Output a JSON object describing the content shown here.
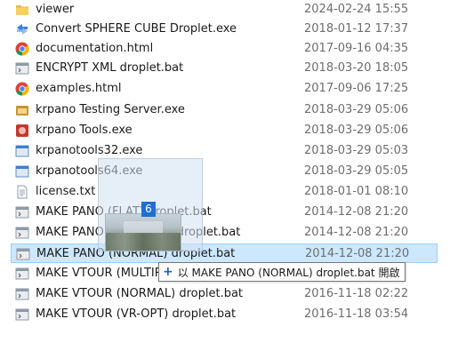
{
  "files": [
    {
      "name": "viewer",
      "date": "2024-02-24 15:55",
      "icon": "folder-icon"
    },
    {
      "name": "Convert SPHERE CUBE Droplet.exe",
      "date": "2018-01-12 17:37",
      "icon": "convert-app-icon"
    },
    {
      "name": "documentation.html",
      "date": "2017-09-16 04:35",
      "icon": "chrome-icon"
    },
    {
      "name": "ENCRYPT XML droplet.bat",
      "date": "2018-03-20 18:05",
      "icon": "bat-file-icon"
    },
    {
      "name": "examples.html",
      "date": "2017-09-06 17:25",
      "icon": "chrome-icon"
    },
    {
      "name": "krpano Testing Server.exe",
      "date": "2018-03-29 05:06",
      "icon": "krpano-icon"
    },
    {
      "name": "krpano Tools.exe",
      "date": "2018-03-29 05:06",
      "icon": "krpano-tools-icon"
    },
    {
      "name": "krpanotools32.exe",
      "date": "2018-03-29 05:03",
      "icon": "exe-icon"
    },
    {
      "name": "krpanotools64.exe",
      "date": "2018-03-29 05:05",
      "icon": "exe-icon"
    },
    {
      "name": "license.txt",
      "date": "2018-01-01 08:10",
      "icon": "text-file-icon"
    },
    {
      "name": "MAKE PANO (FLAT) droplet.bat",
      "date": "2014-12-08 21:20",
      "icon": "bat-file-icon"
    },
    {
      "name": "MAKE PANO (MULTIRES) droplet.bat",
      "date": "2014-12-08 21:20",
      "icon": "bat-file-icon"
    },
    {
      "name": "MAKE PANO (NORMAL) droplet.bat",
      "date": "2014-12-08 21:20",
      "icon": "bat-file-icon",
      "selected": true
    },
    {
      "name": "MAKE VTOUR (MULTIRES) droplet.bat",
      "date": "",
      "icon": "bat-file-icon"
    },
    {
      "name": "MAKE VTOUR (NORMAL) droplet.bat",
      "date": "2016-11-18 02:22",
      "icon": "bat-file-icon"
    },
    {
      "name": "MAKE VTOUR (VR-OPT) droplet.bat",
      "date": "2016-11-18 03:54",
      "icon": "bat-file-icon"
    }
  ],
  "drag": {
    "count": "6",
    "tooltip_plus": "+",
    "tooltip_text": "以 MAKE PANO (NORMAL) droplet.bat 開啟"
  },
  "colors": {
    "selection": "#cce8ff",
    "badge": "#1f6fd1"
  }
}
